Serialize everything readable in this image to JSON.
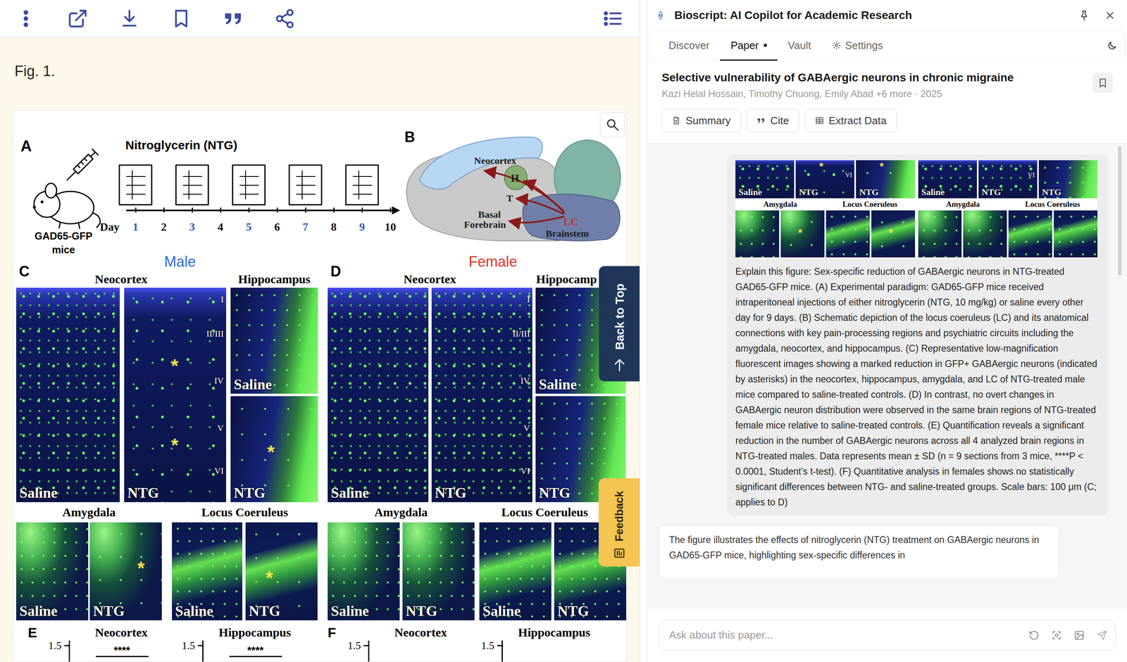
{
  "viewer": {
    "caption": "Fig. 1."
  },
  "figure": {
    "panel_a": {
      "letter": "A",
      "drug": "Nitroglycerin (NTG)",
      "mouse_label": [
        "GAD65-GFP",
        "mice"
      ],
      "axis_label": "Day",
      "days": [
        {
          "label": "1",
          "color": "#2d5cb6",
          "injection": true
        },
        {
          "label": "2",
          "color": "#111111",
          "injection": false
        },
        {
          "label": "3",
          "color": "#2d5cb6",
          "injection": true
        },
        {
          "label": "4",
          "color": "#111111",
          "injection": false
        },
        {
          "label": "5",
          "color": "#2d5cb6",
          "injection": true
        },
        {
          "label": "6",
          "color": "#111111",
          "injection": false
        },
        {
          "label": "7",
          "color": "#2d5cb6",
          "injection": true
        },
        {
          "label": "8",
          "color": "#111111",
          "injection": false
        },
        {
          "label": "9",
          "color": "#2d5cb6",
          "injection": true
        },
        {
          "label": "10",
          "color": "#111111",
          "injection": false
        }
      ]
    },
    "panel_b": {
      "letter": "B",
      "labels": [
        {
          "text": "Neocortex",
          "color": "#1a1a1a"
        },
        {
          "text": "H",
          "color": "#1a1a1a"
        },
        {
          "text": "T",
          "color": "#1a1a1a"
        },
        {
          "text": "Basal",
          "color": "#1a1a1a"
        },
        {
          "text": "Forebrain",
          "color": "#1a1a1a"
        },
        {
          "text": "LC",
          "color": "#d42a1f"
        },
        {
          "text": "Brainstem",
          "color": "#1a1a1a"
        }
      ]
    },
    "groups": [
      {
        "letter": "C",
        "sex": "Male",
        "color": "#2f6bd6",
        "region_titles": [
          "Neocortex",
          "Hippocampus",
          "Amygdala",
          "Locus Coeruleus"
        ],
        "neocortex": [
          {
            "label": "Saline",
            "marks": [],
            "layers": []
          },
          {
            "label": "NTG",
            "marks": [
              "*",
              "*"
            ],
            "layers": [
              "I",
              "II/III",
              "IV",
              "V",
              "VI"
            ]
          }
        ],
        "hippocampus": [
          {
            "label": "Saline",
            "marks": []
          },
          {
            "label": "NTG",
            "marks": [
              "*"
            ]
          }
        ],
        "amygdala": [
          {
            "label": "Saline",
            "marks": []
          },
          {
            "label": "NTG",
            "marks": [
              "*"
            ]
          }
        ],
        "locus_coeruleus": [
          {
            "label": "Saline",
            "marks": []
          },
          {
            "label": "NTG",
            "marks": [
              "*"
            ]
          }
        ]
      },
      {
        "letter": "D",
        "sex": "Female",
        "color": "#e0352b",
        "region_titles": [
          "Neocortex",
          "Hippocamp",
          "Amygdala",
          "Locus Coeruleus"
        ],
        "neocortex": [
          {
            "label": "Saline",
            "marks": [],
            "layers": []
          },
          {
            "label": "NTG",
            "marks": [],
            "layers": [
              "I",
              "II/III",
              "IV",
              "V",
              "VI"
            ]
          }
        ],
        "hippocampus": [
          {
            "label": "Saline",
            "marks": []
          },
          {
            "label": "NTG",
            "marks": []
          }
        ],
        "amygdala": [
          {
            "label": "Saline",
            "marks": []
          },
          {
            "label": "NTG",
            "marks": []
          }
        ],
        "locus_coeruleus": [
          {
            "label": "Saline",
            "marks": []
          },
          {
            "label": "NTG",
            "marks": []
          }
        ]
      }
    ],
    "charts": [
      {
        "letter": "E",
        "plots": [
          {
            "title": "Neocortex",
            "tick": "1.5",
            "significance": "****"
          },
          {
            "title": "Hippocampus",
            "tick": "1.5",
            "significance": "****"
          }
        ]
      },
      {
        "letter": "F",
        "plots": [
          {
            "title": "Neocortex",
            "tick": "1.5"
          },
          {
            "title": "Hippocampus",
            "tick": "1.5"
          }
        ]
      }
    ]
  },
  "overlays": {
    "back_to_top": "Back to Top",
    "feedback": "Feedback"
  },
  "copilot": {
    "title": "Bioscript: AI Copilot for Academic Research",
    "tabs": [
      {
        "label": "Discover",
        "selected": false,
        "dot": false,
        "kind": "plain"
      },
      {
        "label": "Paper",
        "selected": true,
        "dot": true,
        "kind": "plain"
      },
      {
        "label": "Vault",
        "selected": false,
        "dot": false,
        "kind": "plain"
      },
      {
        "label": "Settings",
        "selected": false,
        "dot": false,
        "kind": "settings"
      }
    ],
    "paper": {
      "title": "Selective vulnerability of GABAergic neurons in chronic migraine",
      "meta": "Kazi Helal Hossain, Timothy Chuong, Emily Abad +6 more · 2025",
      "actions": [
        {
          "label": "Summary",
          "kind": "summary"
        },
        {
          "label": "Cite",
          "kind": "cite"
        },
        {
          "label": "Extract Data",
          "kind": "extract"
        }
      ]
    },
    "messages": [
      {
        "role": "user",
        "attachment": {
          "halves": [
            {
              "top": [
                {
                  "label": "Saline",
                  "marks": [],
                  "layers": []
                },
                {
                  "label": "NTG",
                  "marks": [
                    "*"
                  ],
                  "layers": [
                    "VI"
                  ]
                },
                {
                  "label": "NTG",
                  "marks": [
                    "*"
                  ],
                  "layers": []
                }
              ],
              "region_titles": [
                "Amygdala",
                "Locus Coeruleus"
              ],
              "bottom": [
                {
                  "marks": []
                },
                {
                  "marks": [
                    "*"
                  ]
                },
                {
                  "marks": []
                },
                {
                  "marks": [
                    "*"
                  ]
                }
              ]
            },
            {
              "top": [
                {
                  "label": "Saline",
                  "marks": [],
                  "layers": []
                },
                {
                  "label": "NTG",
                  "marks": [],
                  "layers": [
                    "VI"
                  ]
                },
                {
                  "label": "NTG",
                  "marks": [],
                  "layers": []
                }
              ],
              "region_titles": [
                "Amygdala",
                "Locus Coeruleus"
              ],
              "bottom": [
                {
                  "marks": []
                },
                {
                  "marks": []
                },
                {
                  "marks": []
                },
                {
                  "marks": []
                }
              ]
            }
          ]
        },
        "text": "Explain this figure: Sex-specific reduction of GABAergic neurons in NTG-treated GAD65-GFP mice. (A) Experimental paradigm: GAD65-GFP mice received intraperitoneal injections of either nitroglycerin (NTG, 10 mg/kg) or saline every other day for 9 days. (B) Schematic depiction of the locus coeruleus (LC) and its anatomical connections with key pain-processing regions and psychiatric circuits including the amygdala, neocortex, and hippocampus. (C) Representative low-magnification fluorescent images showing a marked reduction in GFP+ GABAergic neurons (indicated by asterisks) in the neocortex, hippocampus, amygdala, and LC of NTG-treated male mice compared to saline-treated controls. (D) In contrast, no overt changes in GABAergic neuron distribution were observed in the same brain regions of NTG-treated female mice relative to saline-treated controls. (E) Quantification reveals a significant reduction in the number of GABAergic neurons across all 4 analyzed brain regions in NTG-treated males. Data represents mean ± SD (n = 9 sections from 3 mice, ****P < 0.0001, Student’s t-test). (F) Quantitative analysis in females shows no statistically significant differences between NTG- and saline-treated groups. Scale bars: 100 μm (C; applies to D)"
      },
      {
        "role": "assistant",
        "text": "The figure illustrates the effects of nitroglycerin (NTG) treatment on GABAergic neurons in GAD65-GFP mice, highlighting sex-specific differences in"
      }
    ],
    "input": {
      "placeholder": "Ask about this paper..."
    }
  }
}
